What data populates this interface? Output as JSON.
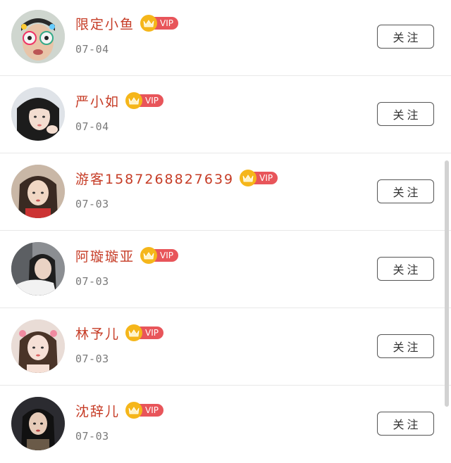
{
  "vip_label": "VIP",
  "follow_label": "关注",
  "users": [
    {
      "name": "限定小鱼",
      "date": "07-04"
    },
    {
      "name": "严小如",
      "date": "07-04"
    },
    {
      "name": "游客1587268827639",
      "date": "07-03"
    },
    {
      "name": "阿璇璇亚",
      "date": "07-03"
    },
    {
      "name": "林予儿",
      "date": "07-03"
    },
    {
      "name": "沈辞儿",
      "date": "07-03"
    }
  ],
  "colors": {
    "name": "#c63c26",
    "vip_tag": "#e8555a",
    "vip_crown": "#f5b61a",
    "date": "#7a7a7a",
    "button_border": "#555555"
  }
}
